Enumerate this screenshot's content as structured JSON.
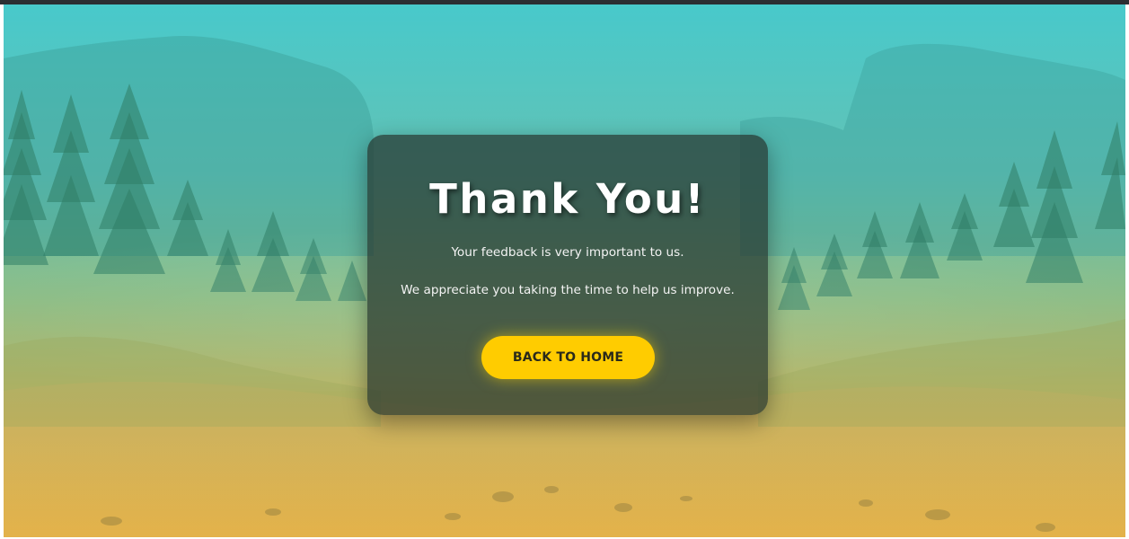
{
  "thank_you_card": {
    "title": "Thank You!",
    "message_line_1": "Your feedback is very important to us.",
    "message_line_2": "We appreciate you taking the time to help us improve.",
    "button_label": "BACK TO HOME"
  },
  "colors": {
    "gradient_top": "#4ccaca",
    "gradient_middle": "#8fbf7a",
    "gradient_bottom": "#e7b64a",
    "card_background": "#26342e",
    "button_background": "#ffcc00",
    "button_text": "#2a2a1a",
    "title_text": "#ffffff"
  }
}
